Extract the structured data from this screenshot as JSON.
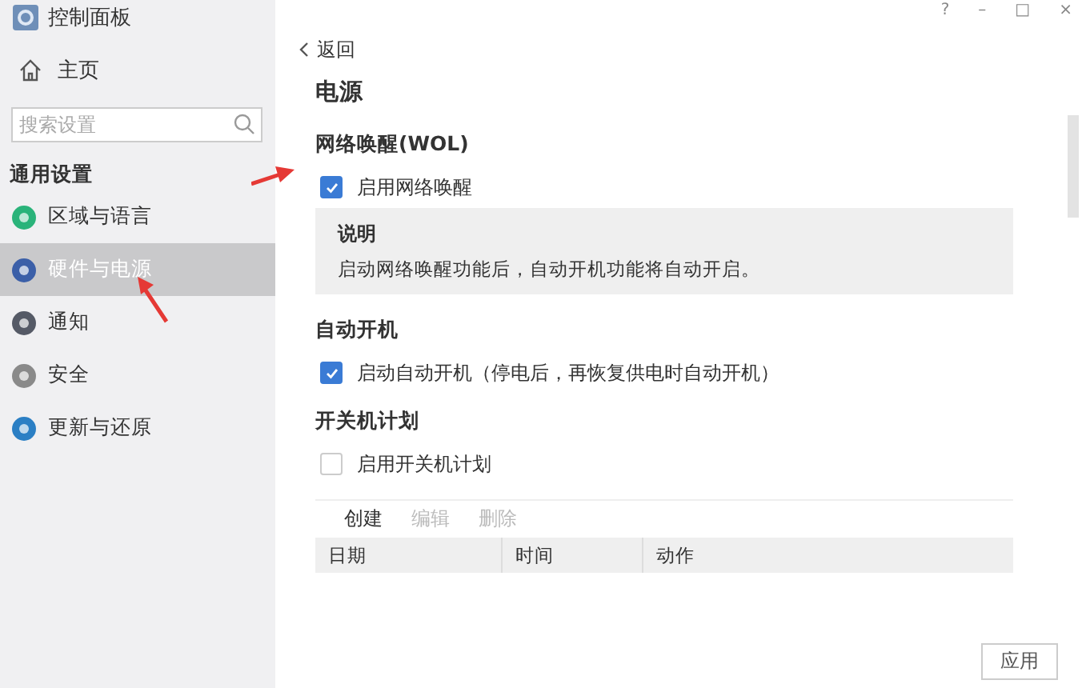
{
  "app": {
    "title": "控制面板"
  },
  "window_controls": [
    "?",
    "–",
    "□",
    "×"
  ],
  "sidebar": {
    "home": "主页",
    "search": {
      "placeholder": "搜索设置"
    },
    "section": "通用设置",
    "items": [
      {
        "label": "区域与语言",
        "selected": false,
        "pointed": false
      },
      {
        "label": "硬件与电源",
        "selected": true,
        "pointed": true
      },
      {
        "label": "通知",
        "selected": false,
        "pointed": false
      },
      {
        "label": "安全",
        "selected": false,
        "pointed": false
      },
      {
        "label": "更新与还原",
        "selected": false,
        "pointed": false
      }
    ]
  },
  "back": "返回",
  "page_title": "电源",
  "sections": [
    {
      "heading": "网络唤醒(WOL)",
      "option": {
        "label": "启用网络唤醒",
        "checked": true,
        "pointed": true
      },
      "note": {
        "title": "说明",
        "text": "启动网络唤醒功能后，自动开机功能将自动开启。"
      }
    },
    {
      "heading": "自动开机",
      "option": {
        "label": "启动自动开机（停电后，再恢复供电时自动开机）",
        "checked": true,
        "pointed": false
      }
    },
    {
      "heading": "开关机计划",
      "option": {
        "label": "启用开关机计划",
        "checked": false,
        "pointed": false
      }
    }
  ],
  "toolbar": [
    {
      "label": "创建",
      "disabled": false
    },
    {
      "label": "编辑",
      "disabled": true
    },
    {
      "label": "删除",
      "disabled": true
    }
  ],
  "table": {
    "columns": [
      "日期",
      "时间",
      "动作"
    ]
  },
  "apply": "应用"
}
